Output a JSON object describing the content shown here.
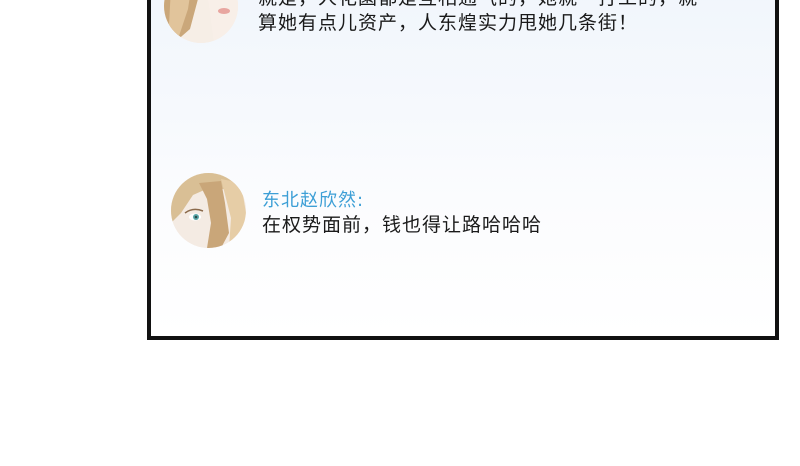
{
  "messages": [
    {
      "avatar_icon": "woman-portrait-avatar",
      "text_line1": "就是，人花園都是互相通气的，她就一打工的，就",
      "text_line2": "算她有点儿资产，人东煌实力甩她几条街！"
    },
    {
      "avatar_icon": "woman-portrait-avatar",
      "sender": "东北赵欣然:",
      "text": "在权势面前，钱也得让路哈哈哈"
    }
  ],
  "colors": {
    "sender": "#3d9fd6",
    "text": "#1a1a1a",
    "panel_border": "#111111"
  }
}
